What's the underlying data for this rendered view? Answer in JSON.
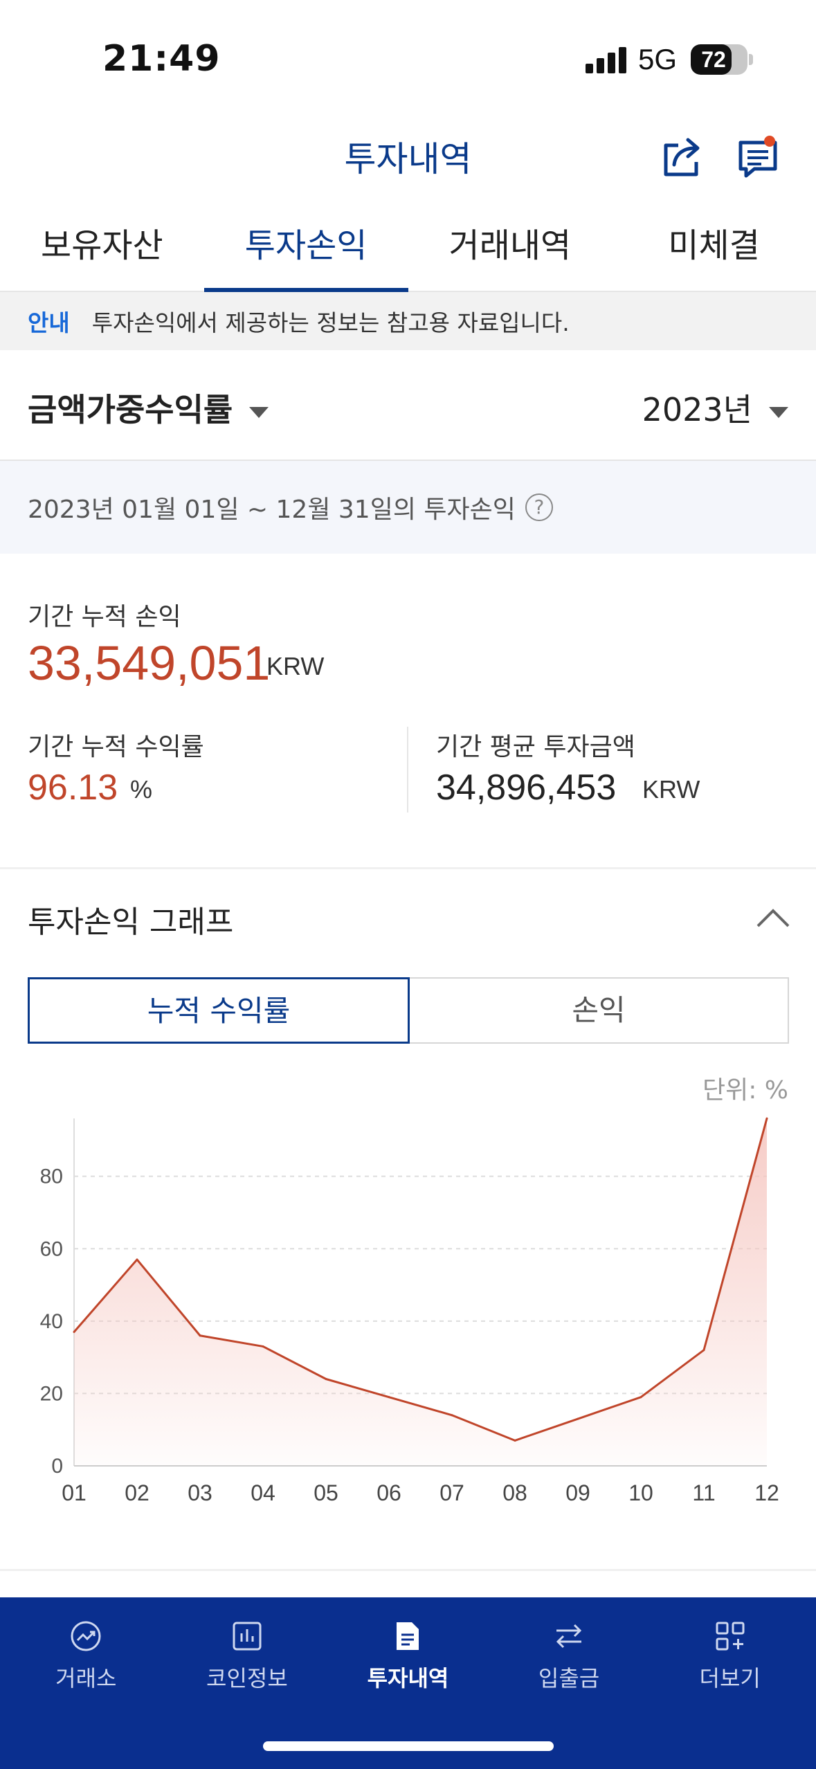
{
  "status": {
    "time": "21:49",
    "network": "5G",
    "battery": "72",
    "battery_level": 72
  },
  "header": {
    "title": "투자내역"
  },
  "tabs": [
    {
      "label": "보유자산",
      "active": false
    },
    {
      "label": "투자손익",
      "active": true
    },
    {
      "label": "거래내역",
      "active": false
    },
    {
      "label": "미체결",
      "active": false
    }
  ],
  "notice": {
    "label": "안내",
    "text": "투자손익에서 제공하는 정보는 참고용 자료입니다."
  },
  "filters": {
    "metric": "금액가중수익률",
    "year": "2023년"
  },
  "period": {
    "text": "2023년 01월 01일 ~ 12월 31일의 투자손익",
    "help": "?"
  },
  "summary": {
    "cum_pl_label": "기간 누적 손익",
    "cum_pl_value": "33,549,051",
    "cum_pl_unit": "KRW",
    "cum_rate_label": "기간 누적 수익률",
    "cum_rate_value": "96.13",
    "cum_rate_unit": "%",
    "avg_invest_label": "기간 평균 투자금액",
    "avg_invest_value": "34,896,453",
    "avg_invest_unit": "KRW"
  },
  "graph": {
    "title": "투자손익 그래프",
    "seg_cum": "누적 수익률",
    "seg_pl": "손익",
    "unit_label": "단위: %"
  },
  "chart_data": {
    "type": "area",
    "categories": [
      "01",
      "02",
      "03",
      "04",
      "05",
      "06",
      "07",
      "08",
      "09",
      "10",
      "11",
      "12"
    ],
    "series": [
      {
        "values": [
          37,
          57,
          36,
          33,
          24,
          19,
          14,
          7,
          13,
          19,
          32,
          96
        ]
      }
    ],
    "y_ticks": [
      "0",
      "20",
      "40",
      "60",
      "80"
    ],
    "ylim": [
      0,
      96
    ],
    "grid": true,
    "colors": {
      "line": "#c0452a",
      "fill": "#f5c6c0",
      "grid": "#dddddd"
    }
  },
  "nav": [
    {
      "label": "거래소",
      "icon": "exchange-chart-icon",
      "active": false
    },
    {
      "label": "코인정보",
      "icon": "bar-chart-icon",
      "active": false
    },
    {
      "label": "투자내역",
      "icon": "document-icon",
      "active": true
    },
    {
      "label": "입출금",
      "icon": "transfer-arrows-icon",
      "active": false
    },
    {
      "label": "더보기",
      "icon": "grid-plus-icon",
      "active": false
    }
  ],
  "colors": {
    "brand": "#0a3a8a",
    "nav_bg": "#0a2f8f",
    "profit": "#c0452a"
  }
}
